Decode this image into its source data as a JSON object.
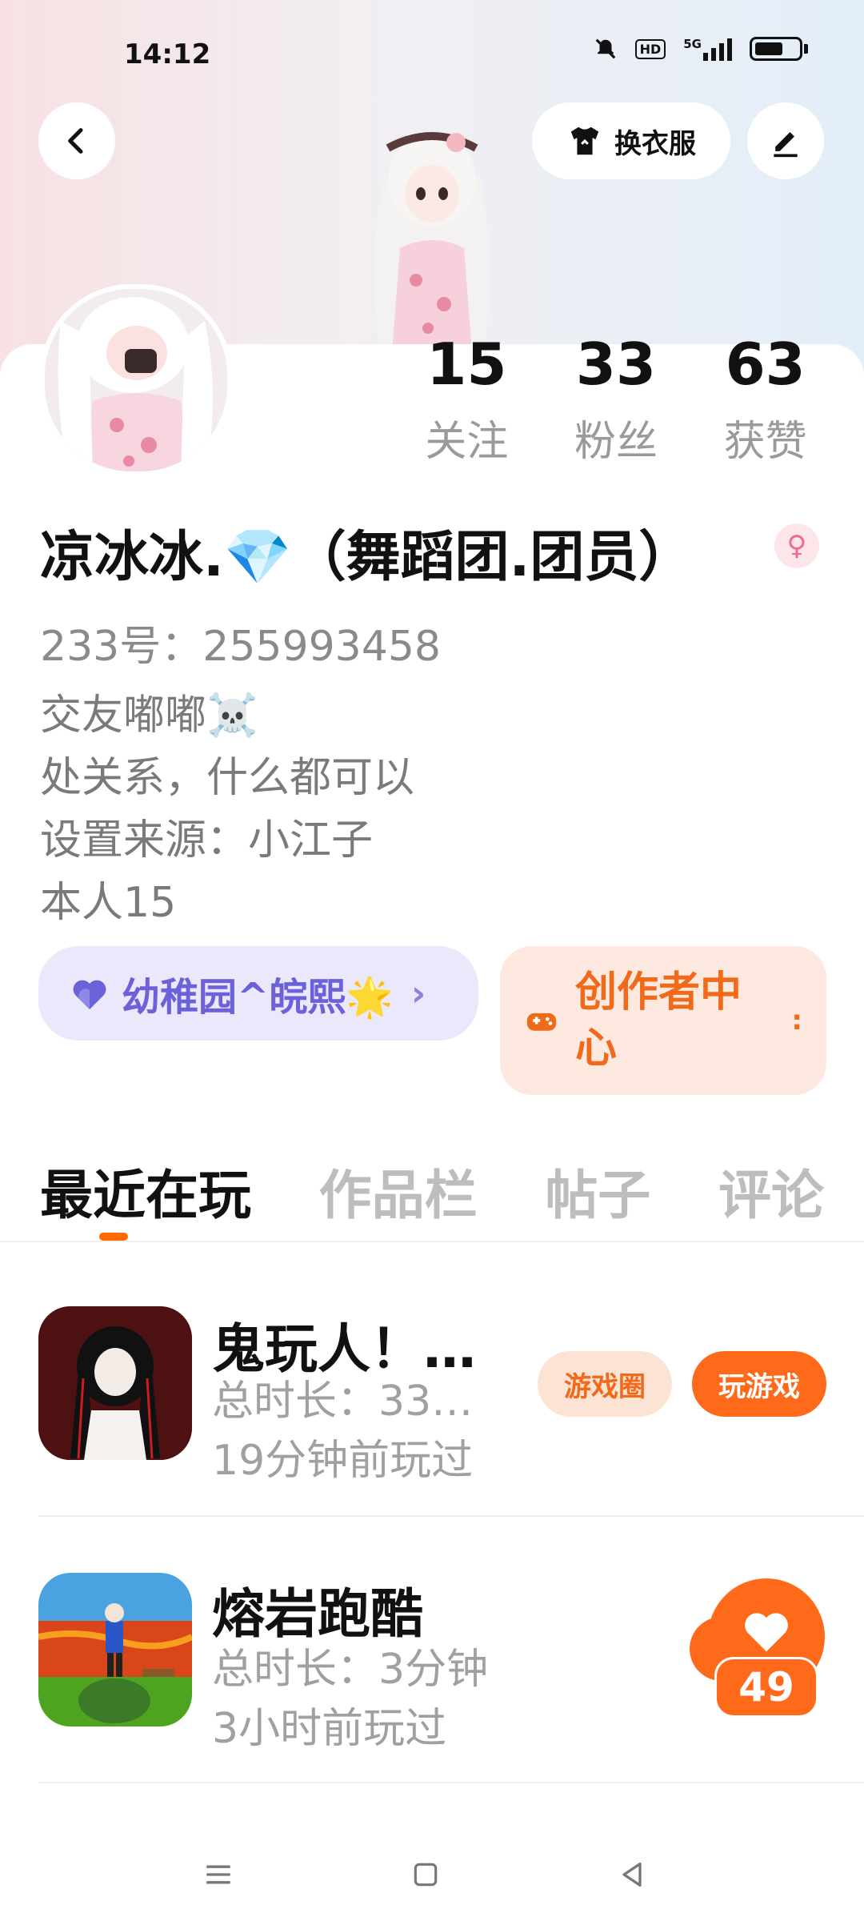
{
  "status_bar": {
    "time": "14:12",
    "hd": "HD",
    "network": "5G"
  },
  "header": {
    "outfit_label": "换衣服",
    "icons": {
      "back": "chevron-left-icon",
      "outfit": "tshirt-icon",
      "edit": "pencil-icon"
    }
  },
  "stats": [
    {
      "value": "15",
      "label": "关注"
    },
    {
      "value": "33",
      "label": "粉丝"
    },
    {
      "value": "63",
      "label": "获赞"
    }
  ],
  "profile": {
    "name": "凉冰冰.💎（舞蹈团.团员）",
    "gender_symbol": "♀",
    "id_line": "233号：255993458",
    "bio": [
      "交友嘟嘟☠️",
      "处关系，什么都可以",
      "设置来源：小江子",
      "本人15"
    ]
  },
  "chips": {
    "group_label": "幼稚园^皖熙🌟",
    "group_arrow": "›",
    "creator_label": "创作者中心",
    "creator_arrow": ":"
  },
  "tabs": [
    {
      "label": "最近在玩",
      "active": true
    },
    {
      "label": "作品栏",
      "active": false
    },
    {
      "label": "帖子",
      "active": false
    },
    {
      "label": "评论",
      "active": false
    }
  ],
  "games": [
    {
      "title": "鬼玩人！…",
      "duration": "总时长：33…",
      "last_played": "19分钟前玩过",
      "circle_label": "游戏圈",
      "play_label": "玩游戏"
    },
    {
      "title": "熔岩跑酷",
      "duration": "总时长：3分钟",
      "last_played": "3小时前玩过"
    }
  ],
  "like": {
    "count": "49"
  },
  "colors": {
    "accent": "#ff6a1a",
    "group_purple": "#6b62d9"
  }
}
